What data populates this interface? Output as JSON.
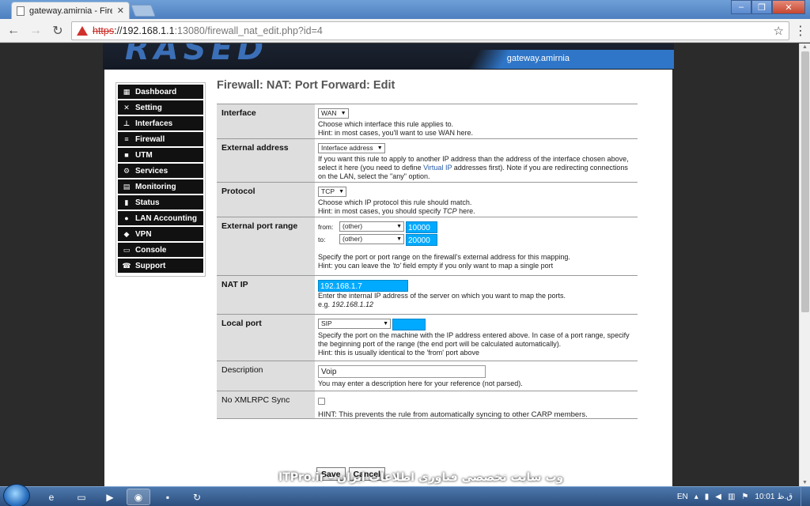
{
  "browser": {
    "tab_title": "gateway.amirnia - Firewa",
    "url_scheme": "https",
    "url_host": "://192.168.1.1",
    "url_path": ":13080/firewall_nat_edit.php?id=4",
    "window_controls": [
      "–",
      "❐",
      "✕"
    ]
  },
  "banner": {
    "logo": "RASED",
    "hostname": "gateway.amirnia"
  },
  "sidebar": {
    "items": [
      {
        "label": "Dashboard",
        "icon": "grid-icon"
      },
      {
        "label": "Setting",
        "icon": "tools-icon"
      },
      {
        "label": "Interfaces",
        "icon": "network-icon"
      },
      {
        "label": "Firewall",
        "icon": "firewall-icon"
      },
      {
        "label": "UTM",
        "icon": "lock-icon"
      },
      {
        "label": "Services",
        "icon": "gear-icon"
      },
      {
        "label": "Monitoring",
        "icon": "chart-icon"
      },
      {
        "label": "Status",
        "icon": "bars-icon"
      },
      {
        "label": "LAN Accounting",
        "icon": "people-icon"
      },
      {
        "label": "VPN",
        "icon": "vpn-icon"
      },
      {
        "label": "Console",
        "icon": "console-icon"
      },
      {
        "label": "Support",
        "icon": "phone-icon"
      }
    ]
  },
  "page": {
    "title": "Firewall: NAT: Port Forward: Edit"
  },
  "form": {
    "interface": {
      "label": "Interface",
      "value": "WAN",
      "help1": "Choose which interface this rule applies to.",
      "help2": "Hint: in most cases, you'll want to use WAN here."
    },
    "external_address": {
      "label": "External address",
      "value": "Interface address",
      "help_a": "If you want this rule to apply to another IP address than the address of the interface chosen above, select it here (you need to define ",
      "help_link": "Virtual IP",
      "help_b": " addresses first). Note if you are redirecting connections on the LAN, select the \"any\" option."
    },
    "protocol": {
      "label": "Protocol",
      "value": "TCP",
      "help1": "Choose which IP protocol this rule should match.",
      "help2a": "Hint: in most cases, you should specify ",
      "help2em": "TCP",
      "help2b": " here."
    },
    "ext_port_range": {
      "label": "External port range",
      "from_label": "from:",
      "from_select": "(other)",
      "from_value": "10000",
      "to_label": "to:",
      "to_select": "(other)",
      "to_value": "20000",
      "help1": "Specify the port or port range on the firewall's external address for this mapping.",
      "help2a": "Hint: you can leave the ",
      "help2em": "'to'",
      "help2b": " field empty if you only want to map a single port"
    },
    "nat_ip": {
      "label": "NAT IP",
      "value": "192.168.1.7",
      "help1": "Enter the internal IP address of the server on which you want to map the ports.",
      "help2a": "e.g. ",
      "help2em": "192.168.1.12"
    },
    "local_port": {
      "label": "Local port",
      "select": "SIP",
      "value": "",
      "help": "Specify the port on the machine with the IP address entered above. In case of a port range, specify the beginning port of the range (the end port will be calculated automatically).",
      "help2": "Hint: this is usually identical to the 'from' port above"
    },
    "description": {
      "label": "Description",
      "value": "Voip",
      "help": "You may enter a description here for your reference (not parsed)."
    },
    "xmlrpc": {
      "label": "No XMLRPC Sync",
      "checked": false,
      "help": "HINT: This prevents the rule from automatically syncing to other CARP members."
    },
    "save_label": "Save",
    "cancel_label": "Cancel"
  },
  "taskbar": {
    "watermark": "ITPro.ir - وب سایت تخصصی فناوری اطلاعات ایران",
    "lang": "EN",
    "clock": "10:01 ق.ظ"
  }
}
